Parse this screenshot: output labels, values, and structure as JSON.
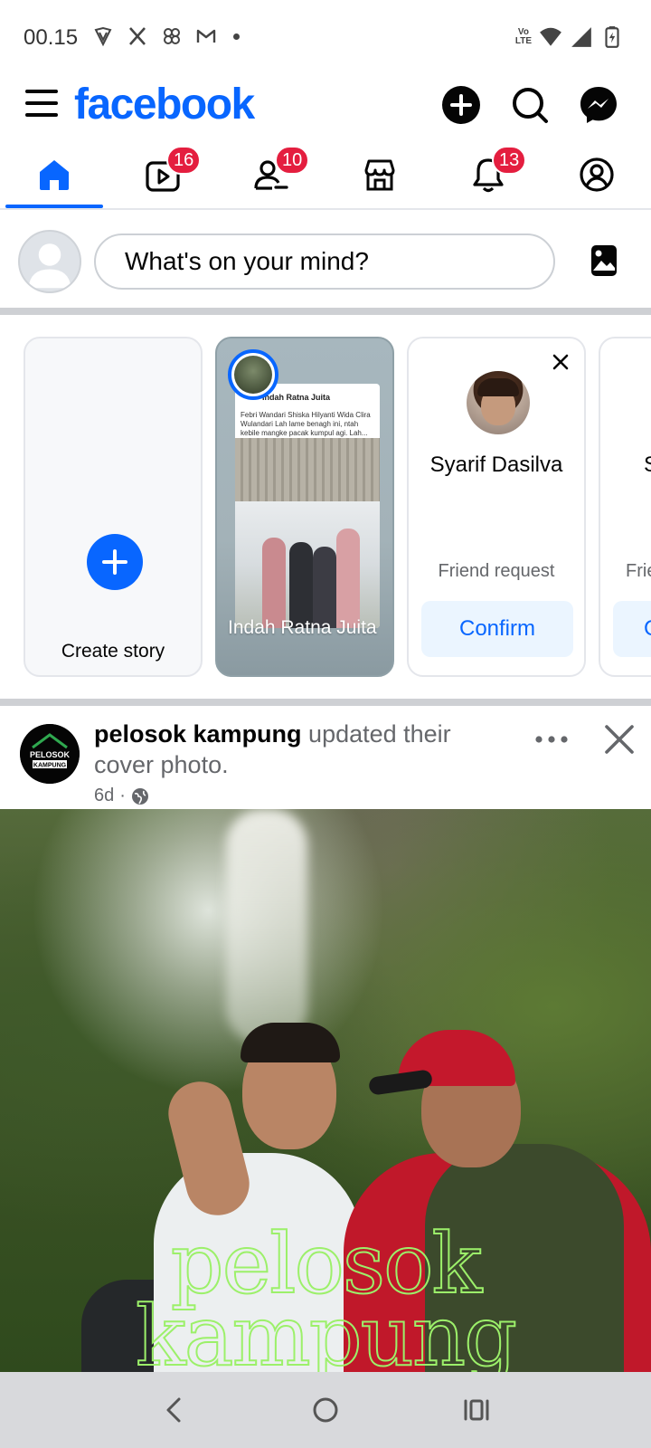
{
  "status_bar": {
    "time": "00.15",
    "left_icons": [
      "vpn-shield-icon",
      "x-app-icon",
      "pinwheel-icon",
      "gmail-icon",
      "notification-dot-icon"
    ],
    "volte": [
      "Vo",
      "LTE"
    ],
    "right_icons": [
      "wifi-icon",
      "signal-icon",
      "battery-charging-icon"
    ]
  },
  "header": {
    "logo": "facebook",
    "brand_color": "#0866ff",
    "actions": [
      "create-icon",
      "search-icon",
      "messenger-icon"
    ]
  },
  "tabs": [
    {
      "name": "home",
      "icon": "home-icon",
      "active": true,
      "badge": ""
    },
    {
      "name": "video",
      "icon": "video-icon",
      "active": false,
      "badge": "16"
    },
    {
      "name": "friends",
      "icon": "friends-icon",
      "active": false,
      "badge": "10"
    },
    {
      "name": "marketplace",
      "icon": "marketplace-icon",
      "active": false,
      "badge": ""
    },
    {
      "name": "notifications",
      "icon": "bell-icon",
      "active": false,
      "badge": "13"
    },
    {
      "name": "profile",
      "icon": "profile-icon",
      "active": false,
      "badge": ""
    }
  ],
  "composer": {
    "placeholder": "What's on your mind?"
  },
  "stories": {
    "create_label": "Create story",
    "story": {
      "name": "Indah Ratna Juita",
      "post_name": "Indah Ratna Juita",
      "post_text": "Febri Wandari Shiska Hilyanti Wida Clira Wulandari Lah lame benagh ini, ntah kebile mangke pacak kumpul agi. Lah..."
    },
    "friend_request": {
      "name": "Syarif Dasilva",
      "subtitle": "Friend request",
      "confirm_label": "Confirm"
    },
    "next_card": {
      "name_peek": "S",
      "subtitle_peek": "Frie",
      "button_peek": "C"
    }
  },
  "post": {
    "author": "pelosok kampung",
    "action": " updated their cover photo.",
    "time": "6d",
    "separator": "·",
    "privacy_icon": "globe-icon",
    "cover_text_line1": "pelosok",
    "cover_text_line2": "kampung",
    "avatar_text_1": "PELOSOK",
    "avatar_text_2": "KAMPUNG"
  },
  "nav_bar": {
    "buttons": [
      "back-icon",
      "home-circle-icon",
      "recents-icon"
    ]
  }
}
